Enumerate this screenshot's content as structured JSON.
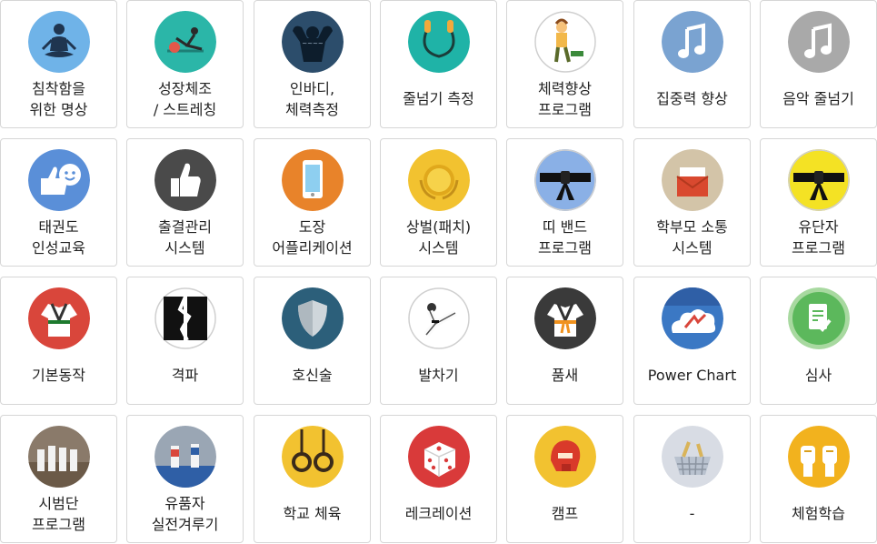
{
  "tiles": [
    {
      "label": "침착함을\n위한 명상",
      "icon": "meditation-icon",
      "color": "#6fb3e8"
    },
    {
      "label": "성장체조\n/ 스트레칭",
      "icon": "stretching-icon",
      "color": "#2bb6a8"
    },
    {
      "label": "인바디,\n체력측정",
      "icon": "bodybuilder-icon",
      "color": "#2c4d6b"
    },
    {
      "label": "줄넘기 측정",
      "icon": "jump-rope-icon",
      "color": "#1fb3a7"
    },
    {
      "label": "체력향상\n프로그램",
      "icon": "fitness-kid-icon",
      "color": "#ffffff"
    },
    {
      "label": "집중력 향상",
      "icon": "music-note-icon",
      "color": "#7aa3d1"
    },
    {
      "label": "음악 줄넘기",
      "icon": "music-note-icon",
      "color": "#a9a9a9"
    },
    {
      "label": "태권도\n인성교육",
      "icon": "thumbs-smile-icon",
      "color": "#5a8fd8"
    },
    {
      "label": "출결관리\n시스템",
      "icon": "thumbs-up-icon",
      "color": "#4a4a4a"
    },
    {
      "label": "도장\n어플리케이션",
      "icon": "smartphone-icon",
      "color": "#e8832a"
    },
    {
      "label": "상벌(패치)\n시스템",
      "icon": "medal-icon",
      "color": "#f2c230"
    },
    {
      "label": "띠 밴드\n프로그램",
      "icon": "black-belt-icon",
      "color": "#8ab0e6"
    },
    {
      "label": "학부모 소통\n시스템",
      "icon": "mail-icon",
      "color": "#d3c4a8"
    },
    {
      "label": "유단자\n프로그램",
      "icon": "black-belt-icon",
      "color": "#f4e224"
    },
    {
      "label": "기본동작",
      "icon": "dobok-icon",
      "color": "#d9463b"
    },
    {
      "label": "격파",
      "icon": "break-board-icon",
      "color": "#ffffff"
    },
    {
      "label": "호신술",
      "icon": "shield-icon",
      "color": "#2c5f7a"
    },
    {
      "label": "발차기",
      "icon": "kick-icon",
      "color": "#ffffff"
    },
    {
      "label": "품새",
      "icon": "dobok-orange-belt-icon",
      "color": "#3a3a3a"
    },
    {
      "label": "Power Chart",
      "icon": "cloud-chart-icon",
      "color": "#3b78c4"
    },
    {
      "label": "심사",
      "icon": "checklist-icon",
      "color": "#5cb85c"
    },
    {
      "label": "시범단\n프로그램",
      "icon": "demo-team-photo-icon",
      "color": "#8a7a6a"
    },
    {
      "label": "유품자\n실전겨루기",
      "icon": "sparring-photo-icon",
      "color": "#9aa6b4"
    },
    {
      "label": "학교 체육",
      "icon": "gymnastic-rings-icon",
      "color": "#f2c230"
    },
    {
      "label": "레크레이션",
      "icon": "dice-icon",
      "color": "#d93a3a"
    },
    {
      "label": "캠프",
      "icon": "helmet-icon",
      "color": "#f2c230"
    },
    {
      "label": "-",
      "icon": "basket-icon",
      "color": "#d8dce4"
    },
    {
      "label": "체험학습",
      "icon": "fists-icon",
      "color": "#f2b21e"
    }
  ]
}
